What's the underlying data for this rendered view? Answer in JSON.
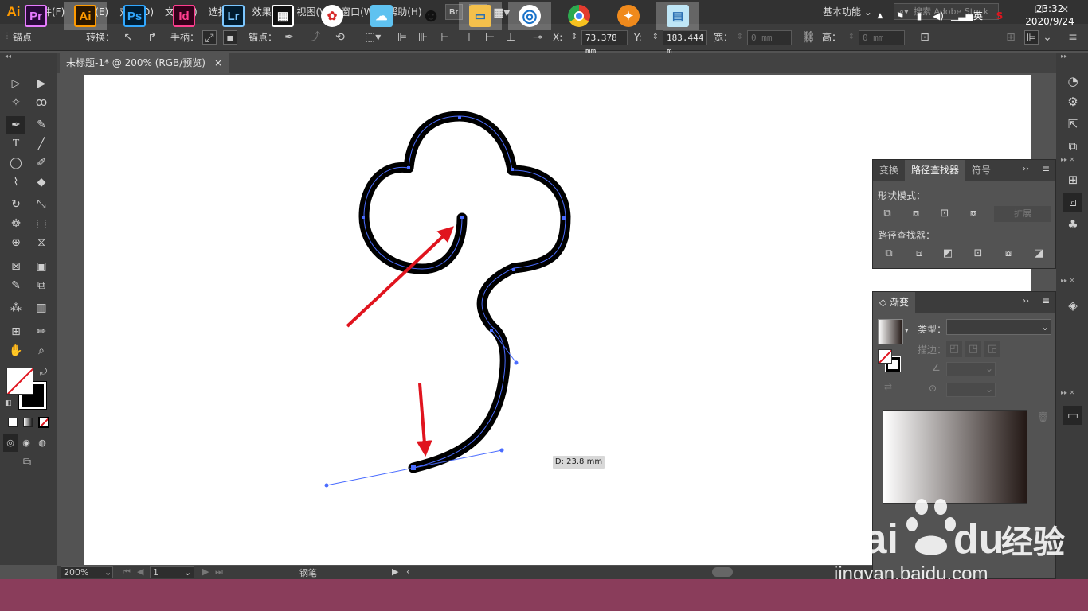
{
  "app": {
    "logo": "Ai"
  },
  "menu": [
    "文件(F)",
    "编辑(E)",
    "对象(O)",
    "文字(T)",
    "选择(S)",
    "效果(C)",
    "视图(V)",
    "窗口(W)",
    "帮助(H)"
  ],
  "menubar_buttons": {
    "bridge": "Br",
    "stock": "St"
  },
  "workspace": "基本功能",
  "stock_search_placeholder": "搜索 Adobe Stock",
  "control_bar": {
    "anchor_label": "锚点",
    "convert_label": "转换：",
    "handle_label": "手柄：",
    "anchor_points_label": "锚点：",
    "x_label": "X:",
    "x_value": "73.378 mm",
    "y_label": "Y:",
    "y_value": "183.444 m",
    "w_label": "宽：",
    "w_value": "0 mm",
    "h_label": "高：",
    "h_value": "0 mm"
  },
  "document_tab": {
    "title": "未标题-1* @ 200% (RGB/预览)",
    "close": "×"
  },
  "canvas": {
    "measure_tooltip": "D: 23.8 mm",
    "annotation_color": "#e0141e",
    "stroke_color": "#000000",
    "path_color": "#4a6cff"
  },
  "pathfinder_panel": {
    "tabs": [
      "变换",
      "路径查找器",
      "符号"
    ],
    "active_tab": "路径查找器",
    "shape_modes_label": "形状模式：",
    "expand_label": "扩展",
    "pathfinders_label": "路径查找器："
  },
  "gradient_panel": {
    "title": "渐变",
    "type_label": "类型：",
    "stroke_label": "描边："
  },
  "status_bar": {
    "zoom": "200%",
    "artboard_number": "1",
    "current_tool": "钢笔"
  },
  "taskbar": {
    "apps": [
      {
        "name": "Pr",
        "bg": "#2a0a3a",
        "fg": "#e77bff"
      },
      {
        "name": "Ai",
        "bg": "#2b1700",
        "fg": "#ff9a00"
      },
      {
        "name": "Ps",
        "bg": "#001d33",
        "fg": "#31a8ff"
      },
      {
        "name": "Id",
        "bg": "#33001a",
        "fg": "#ff3e8e"
      },
      {
        "name": "Lr",
        "bg": "#001b2e",
        "fg": "#7cc7ff"
      }
    ],
    "tray_lang": "英",
    "time": "23:32",
    "date": "2020/9/24"
  },
  "watermark": {
    "brand_left": "Bai",
    "brand_right": "du",
    "cn": "经验",
    "url": "jingyan.baidu.com"
  }
}
